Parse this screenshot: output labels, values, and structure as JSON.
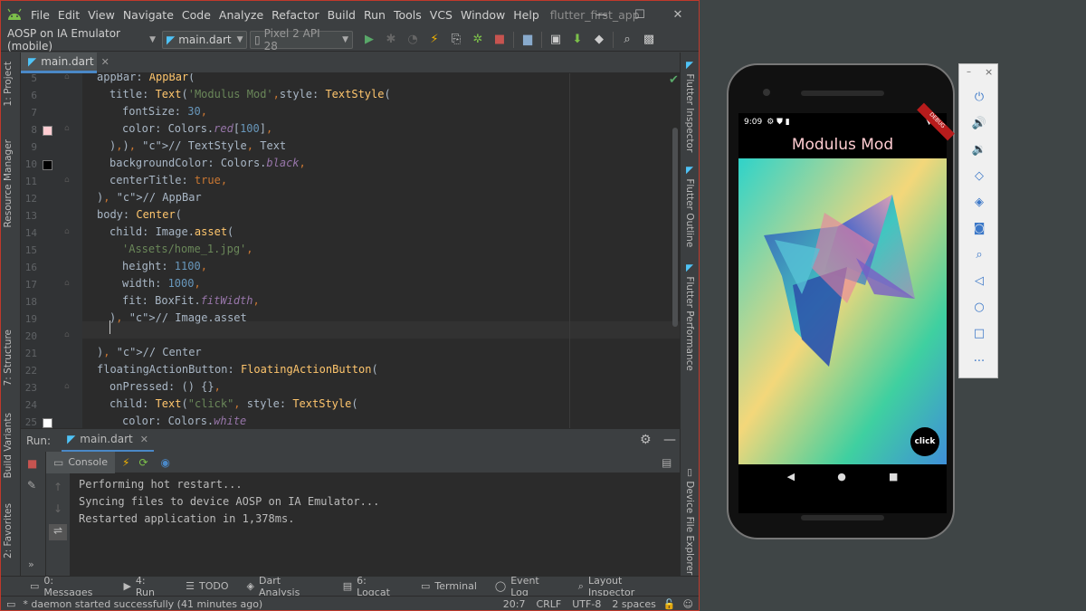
{
  "menu": {
    "items": [
      "File",
      "Edit",
      "View",
      "Navigate",
      "Code",
      "Analyze",
      "Refactor",
      "Build",
      "Run",
      "Tools",
      "VCS",
      "Window",
      "Help"
    ],
    "project": "flutter_first_app",
    "min": "—",
    "max": "☐",
    "close": "✕"
  },
  "toolbar": {
    "device": "AOSP on IA Emulator (mobile)",
    "config": "main.dart",
    "avd": "Pixel 2 API 28"
  },
  "left_tabs": [
    "1: Project",
    "Resource Manager",
    "7: Structure",
    "Build Variants",
    "2: Favorites"
  ],
  "right_tabs": [
    "Flutter Inspector",
    "Flutter Outline",
    "Flutter Performance",
    "Device File Explorer"
  ],
  "editor": {
    "tab": "main.dart",
    "lines": [
      {
        "n": "5",
        "t": "appBar: AppBar("
      },
      {
        "n": "6",
        "t": "title: Text('Modulus Mod',style: TextStyle("
      },
      {
        "n": "7",
        "t": "fontSize: 30,"
      },
      {
        "n": "8",
        "t": "color: Colors.red[100],"
      },
      {
        "n": "9",
        "t": "),), // TextStyle, Text"
      },
      {
        "n": "10",
        "t": "backgroundColor: Colors.black,"
      },
      {
        "n": "11",
        "t": "centerTitle: true,"
      },
      {
        "n": "12",
        "t": "), // AppBar"
      },
      {
        "n": "13",
        "t": "body: Center("
      },
      {
        "n": "14",
        "t": "child: Image.asset("
      },
      {
        "n": "15",
        "t": "'Assets/home_1.jpg',"
      },
      {
        "n": "16",
        "t": "height: 1100,"
      },
      {
        "n": "17",
        "t": "width: 1000,"
      },
      {
        "n": "18",
        "t": "fit: BoxFit.fitWidth,"
      },
      {
        "n": "19",
        "t": "), // Image.asset"
      },
      {
        "n": "20",
        "t": ""
      },
      {
        "n": "21",
        "t": "), // Center"
      },
      {
        "n": "22",
        "t": "floatingActionButton: FloatingActionButton("
      },
      {
        "n": "23",
        "t": "onPressed: () {},"
      },
      {
        "n": "24",
        "t": "child: Text(\"click\", style: TextStyle("
      },
      {
        "n": "25",
        "t": "color: Colors.white"
      }
    ],
    "swatch_colors": {
      "8": "#ffcdd2",
      "10": "#000000",
      "25": "#ffffff"
    }
  },
  "run": {
    "label": "Run:",
    "config": "main.dart",
    "console_tab": "Console",
    "output": [
      "Performing hot restart...",
      "Syncing files to device AOSP on IA Emulator...",
      "Restarted application in 1,378ms."
    ]
  },
  "bottom_tabs": [
    "0: Messages",
    "4: Run",
    "TODO",
    "Dart Analysis",
    "6: Logcat",
    "Terminal"
  ],
  "bottom_right": [
    "Event Log",
    "Layout Inspector"
  ],
  "status": {
    "message": "* daemon started successfully (41 minutes ago)",
    "pos": "20:7",
    "eol": "CRLF",
    "enc": "UTF-8",
    "indent": "2 spaces"
  },
  "emulator": {
    "time": "9:09",
    "title": "Modulus Mod",
    "fab": "click",
    "debug_banner": "DEBUG",
    "title_color": "#ffcdd2",
    "emu_min": "–",
    "emu_close": "×",
    "emu_more": "···"
  }
}
